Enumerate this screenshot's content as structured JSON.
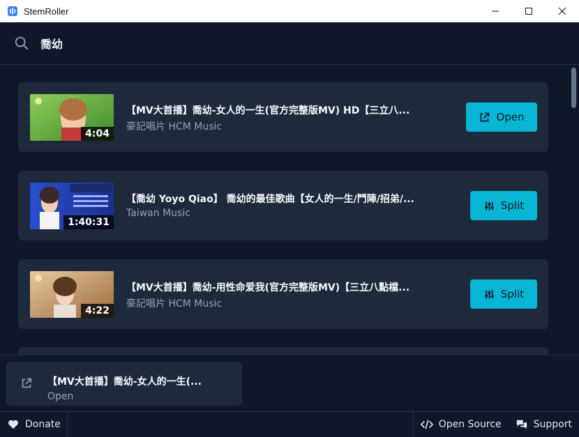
{
  "window": {
    "title": "StemRoller"
  },
  "search": {
    "value": "喬幼",
    "placeholder": ""
  },
  "results": [
    {
      "title": "【MV大首播】喬幼-女人的一生(官方完整版MV) HD【三立八...",
      "channel": "豪記唱片 HCM Music",
      "duration": "4:04",
      "action": "Open",
      "action_icon": "external-link-icon"
    },
    {
      "title": "【喬幼 Yoyo Qiao】 喬幼的最佳歌曲【女人的一生/鬥陣/招弟/...",
      "channel": "Taiwan Music",
      "duration": "1:40:31",
      "action": "Split",
      "action_icon": "sliders-icon"
    },
    {
      "title": "【MV大首播】喬幼-用性命爱我(官方完整版MV)【三立八點檔...",
      "channel": "豪記唱片 HCM Music",
      "duration": "4:22",
      "action": "Split",
      "action_icon": "sliders-icon"
    }
  ],
  "queue": {
    "title": "【MV大首播】喬幼-女人的一生(...",
    "status": "Open"
  },
  "footer": {
    "donate": "Donate",
    "open_source": "Open Source",
    "support": "Support"
  },
  "colors": {
    "background": "#0f1729",
    "card": "#1e293b",
    "accent": "#06b6d4",
    "muted_text": "#94a3b8"
  }
}
